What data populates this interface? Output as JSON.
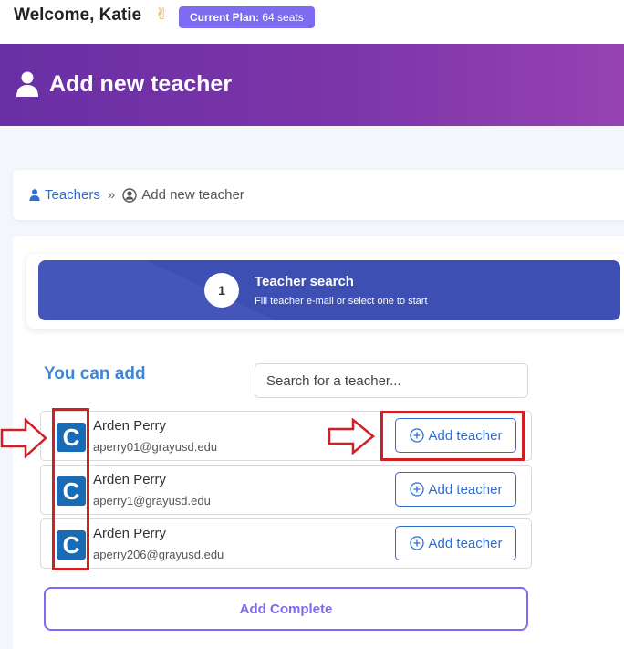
{
  "header": {
    "welcome": "Welcome, Katie",
    "wave_emoji": "✌",
    "plan_label": "Current Plan:",
    "plan_value": "64 seats"
  },
  "banner": {
    "title": "Add new teacher",
    "icon": "user-icon"
  },
  "breadcrumb": {
    "parent_label": "Teachers",
    "separator": "»",
    "current_label": "Add new teacher"
  },
  "step": {
    "number": "1",
    "title": "Teacher search",
    "subtitle": "Fill teacher e-mail or select one to start"
  },
  "section": {
    "title": "You can add"
  },
  "search": {
    "placeholder": "Search for a teacher..."
  },
  "teachers": [
    {
      "name": "Arden Perry",
      "email": "aperry01@grayusd.edu",
      "logo_letter": "C",
      "button": "Add teacher"
    },
    {
      "name": "Arden Perry",
      "email": "aperry1@grayusd.edu",
      "logo_letter": "C",
      "button": "Add teacher"
    },
    {
      "name": "Arden Perry",
      "email": "aperry206@grayusd.edu",
      "logo_letter": "C",
      "button": "Add teacher"
    }
  ],
  "complete_button": "Add Complete",
  "colors": {
    "brand_purple": "#7d6bf2",
    "banner_start": "#6a2fa5",
    "banner_end": "#9642b3",
    "link_blue": "#2f6dd0",
    "highlight_red": "#d11f26"
  }
}
